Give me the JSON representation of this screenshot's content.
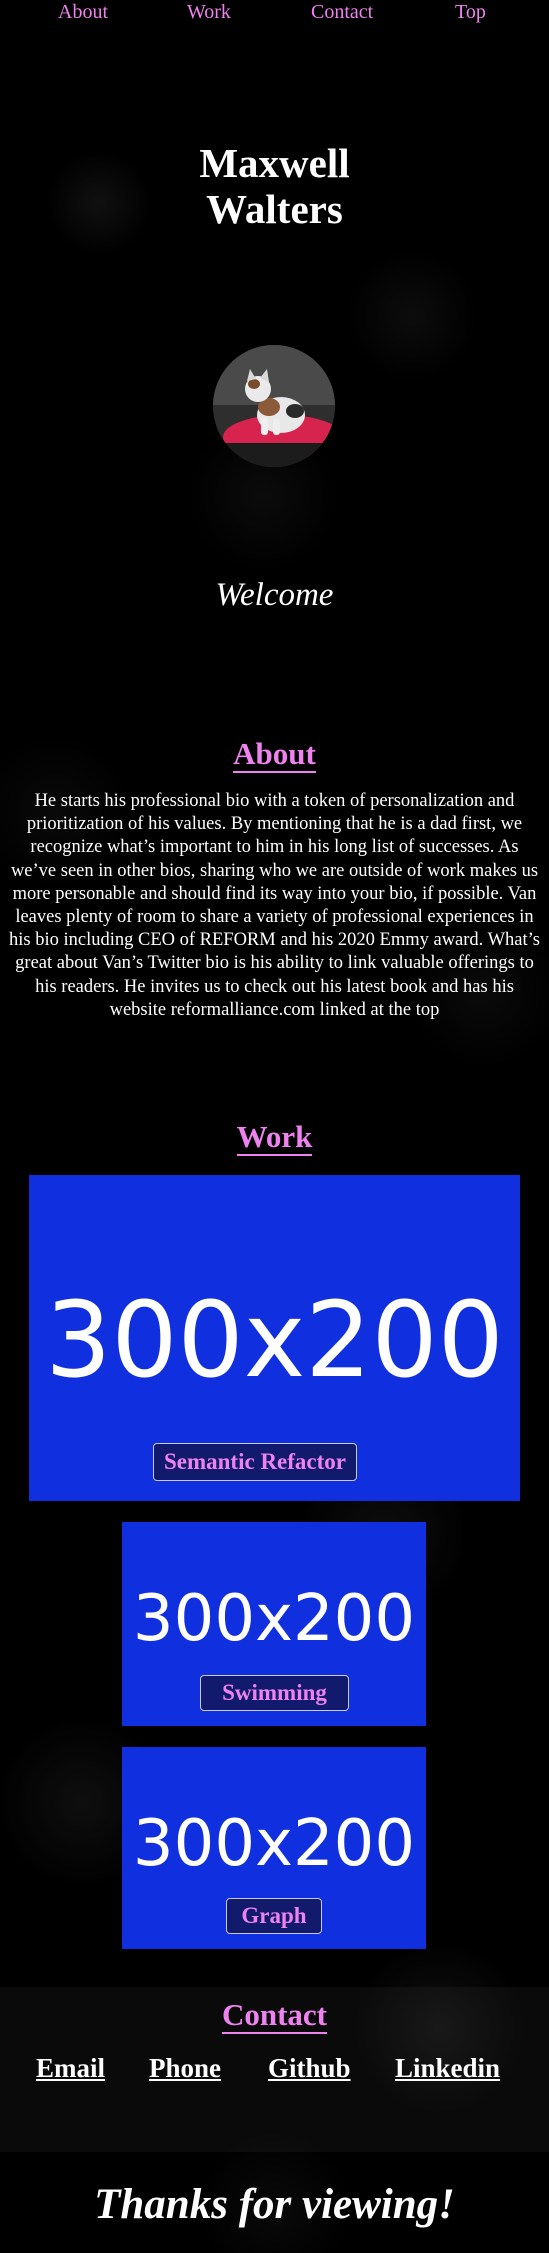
{
  "nav": {
    "items": [
      {
        "label": "About"
      },
      {
        "label": "Work"
      },
      {
        "label": "Contact"
      },
      {
        "label": "Top"
      }
    ]
  },
  "hero": {
    "name_line1": "Maxwell",
    "name_line2": "Walters",
    "welcome": "Welcome"
  },
  "about": {
    "heading": "About",
    "body": "He starts his professional bio with a token of personalization and prioritization of his values. By mentioning that he is a dad first, we recognize what’s important to him in his long list of successes. As we’ve seen in other bios, sharing who we are outside of work makes us more personable and should find its way into your bio, if possible. Van leaves plenty of room to share a variety of professional experiences in his bio including CEO of REFORM and his 2020 Emmy award. What’s great about Van’s Twitter bio is his ability to link valuable offerings to his readers. He invites us to check out his latest book and has his website reformalliance.com linked at the top"
  },
  "work": {
    "heading": "Work",
    "projects": [
      {
        "placeholder": "300x200",
        "label": "Semantic Refactor"
      },
      {
        "placeholder": "300x200",
        "label": "Swimming"
      },
      {
        "placeholder": "300x200",
        "label": "Graph"
      }
    ]
  },
  "contact": {
    "heading": "Contact",
    "links": [
      {
        "label": "Email"
      },
      {
        "label": "Phone"
      },
      {
        "label": "Github"
      },
      {
        "label": "Linkedin"
      }
    ]
  },
  "footer": {
    "thanks": "Thanks for viewing!"
  },
  "colors": {
    "accent": "#ee82ee",
    "placeholder_blue": "#1030e0",
    "background": "#000000"
  }
}
